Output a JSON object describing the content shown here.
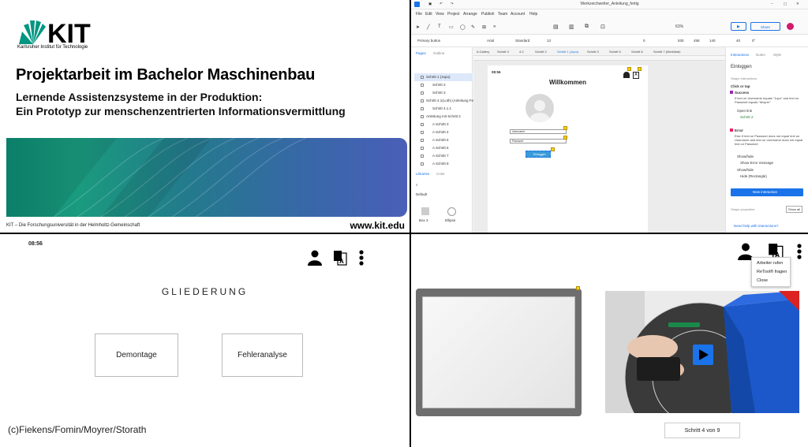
{
  "slide": {
    "logo_text": "KIT",
    "logo_subtitle": "Karlsruher Institut für Technologie",
    "title": "Projektarbeit im Bachelor Maschinenbau",
    "subtitle_line1": "Lernende Assistenzsysteme in der Produktion:",
    "subtitle_line2": "Ein Prototyp zur menschenzentrierten Informationsvermittlung",
    "footer": "KIT – Die Forschungsuniversität in der Helmholtz-Gemeinschaft",
    "url": "www.kit.edu",
    "banner_colors": [
      "#0d8a72",
      "#3867a8"
    ]
  },
  "editor": {
    "window_title": "Werkzeichwelter_Anleitung_fertig",
    "menu": [
      "File",
      "Edit",
      "View",
      "Project",
      "Arrange",
      "Publish",
      "Team",
      "Account",
      "Help"
    ],
    "zoom": "61%",
    "share_label": "Share",
    "format": {
      "style": "Primary button",
      "font": "Arial",
      "weight": "Standard",
      "size": "13",
      "x": "530",
      "y": "458",
      "w": "140",
      "h": "40",
      "rotation": "0°",
      "opacity": "0"
    },
    "left_tabs": [
      "Pages",
      "Outline"
    ],
    "pages": [
      "Schritt 1 (Jupu)",
      "Schritt 2",
      "Schritt 3",
      "Schritt 4.1(Loth) (Anleitung Fehlera",
      "Schritt 4.1.1",
      "Anleitung mit Schritt 2",
      "A Schritt 3",
      "A Schritt 4",
      "A Schritt 5",
      "A Schritt 6",
      "A Schritt 7",
      "A Schritt 8"
    ],
    "libraries_tabs": [
      "Libraries",
      "Color"
    ],
    "library_filter": "Default",
    "library_items": [
      "Box 3",
      "Ellipse"
    ],
    "canvas_tabs": [
      "A Gallery",
      "Schritt 3",
      "4.2",
      "Schritt 2",
      "Schritt 1 (Jupu)",
      "Schritt 3",
      "Schritt 5",
      "Schritt 6",
      "Schritt 7 (Merkliste)"
    ],
    "art": {
      "time": "08:56",
      "heading": "Willkommen",
      "username_label": "Username",
      "password_label": "Passwort",
      "login_label": "Einloggen"
    },
    "right_tabs": [
      "Interactions",
      "Notes",
      "Style"
    ],
    "right": {
      "widget_name": "Einloggen",
      "section": "Shape interactions",
      "event": "Click or tap",
      "case_success": "Success",
      "case_success_cond": "If text on Username equals \"Jupu\" and text on Passwort equals \"Moyrer\"",
      "action_open": "Open link",
      "action_open_target": "Schritt 2",
      "case_error": "Error",
      "case_error_cond": "Else If text on Passwort does not equal text on Username and text on Username does not equal text on Passwort",
      "action_show": "Show/hide",
      "action_show_detail": "Show Error message",
      "action_hide": "Show/hide",
      "action_hide_detail": "Hide (Rectangle)",
      "new_interaction": "New interaction",
      "shape_properties": "Shape properties",
      "show_all": "Show all",
      "help": "Need help with interactions?"
    },
    "accent": "#1a73e8"
  },
  "outline": {
    "time": "08:56",
    "title": "GLIEDERUNG",
    "card1": "Demontage",
    "card2": "Fehleranalyse",
    "credit": "(c)Fiekens/Fomin/Moyrer/Storath"
  },
  "step": {
    "menu_items": [
      "Arbeiter rufen",
      "ReTool® fragen",
      "Close"
    ],
    "step_label": "Schritt 4 von 9",
    "play_color": "#1a73e8"
  }
}
